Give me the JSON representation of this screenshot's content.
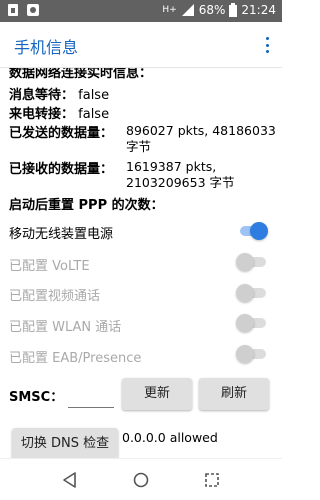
{
  "status_bar": {
    "network": "H+",
    "battery": "68%",
    "time": "21:24"
  },
  "app_bar": {
    "title": "手机信息"
  },
  "rows": {
    "partial_header": "数据网络连接实时信息：",
    "msg_wait_label": "消息等待：",
    "msg_wait_value": "false",
    "call_fwd_label": "来电转接：",
    "call_fwd_value": "false",
    "sent_label": "已发送的数据量：",
    "sent_value": "896027 pkts, 48186033 字节",
    "recv_label": "已接收的数据量：",
    "recv_value": "1619387 pkts, 2103209653 字节",
    "ppp_label": "启动后重置 PPP 的次数："
  },
  "toggles": [
    {
      "label": "移动无线装置电源",
      "on": true,
      "enabled": true
    },
    {
      "label": "已配置 VoLTE",
      "on": false,
      "enabled": false
    },
    {
      "label": "已配置视频通话",
      "on": false,
      "enabled": false
    },
    {
      "label": "已配置 WLAN 通话",
      "on": false,
      "enabled": false
    },
    {
      "label": "已配置 EAB/Presence",
      "on": false,
      "enabled": false
    }
  ],
  "smsc": {
    "label": "SMSC：",
    "input_value": "",
    "update_button": "更新",
    "refresh_button": "刷新"
  },
  "dns": {
    "button": "切换 DNS 检查",
    "result": "0.0.0.0 allowed"
  },
  "colors": {
    "accent": "#1565c0",
    "switch_on": "#2f7de1",
    "status_bar": "#616161"
  },
  "icons": [
    "sim-icon",
    "sync-icon",
    "signal-icon",
    "battery-icon",
    "back-icon",
    "home-icon",
    "recents-icon",
    "overflow-menu-icon"
  ]
}
